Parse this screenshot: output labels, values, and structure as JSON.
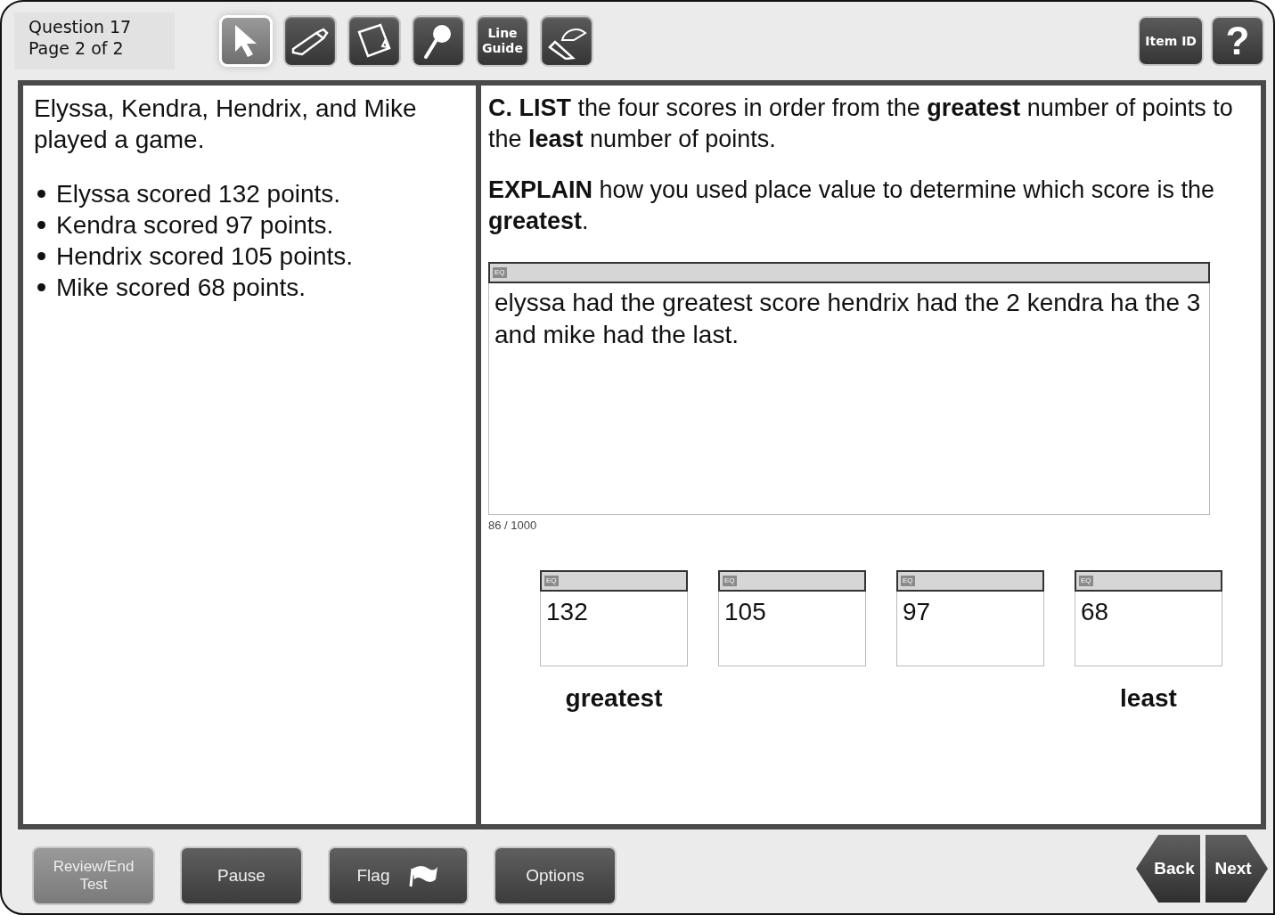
{
  "header": {
    "question": "Question 17",
    "page": "Page 2 of 2"
  },
  "tools": [
    {
      "kind": "pointer",
      "selected": true
    },
    {
      "kind": "highlighter",
      "selected": false
    },
    {
      "kind": "notepad",
      "selected": false
    },
    {
      "kind": "magnifier",
      "selected": false
    },
    {
      "kind": "line-guide",
      "label": "Line Guide",
      "selected": false
    },
    {
      "kind": "protractor",
      "selected": false
    }
  ],
  "help_buttons": [
    {
      "kind": "item-id",
      "label": "Item ID"
    },
    {
      "kind": "help",
      "label": "?"
    }
  ],
  "passage": {
    "intro": "Elyssa, Kendra, Hendrix, and Mike played a game.",
    "bullets": [
      "Elyssa scored 132 points.",
      "Kendra scored 97 points.",
      "Hendrix scored 105 points.",
      "Mike scored 68 points."
    ]
  },
  "question": {
    "paragraphs": [
      "**C.  LIST** the four scores in order from the **greatest** number of points to the **least** number of points.",
      "**EXPLAIN** how you used place value to determine which score is the **greatest**."
    ],
    "response": {
      "eq_label": "EQ",
      "value": "elyssa had the greatest score hendrix had the 2 kendra ha the 3 and mike had the last.",
      "counter": "86 / 1000"
    },
    "order_boxes": [
      {
        "eq_label": "EQ",
        "value": "132",
        "caption": "greatest"
      },
      {
        "eq_label": "EQ",
        "value": "105"
      },
      {
        "eq_label": "EQ",
        "value": "97"
      },
      {
        "eq_label": "EQ",
        "value": "68",
        "caption": "least"
      }
    ]
  },
  "footer": {
    "buttons": [
      {
        "kind": "review",
        "label": "Review/End Test"
      },
      {
        "kind": "pause",
        "label": "Pause"
      },
      {
        "kind": "flag",
        "label": "Flag"
      },
      {
        "kind": "options",
        "label": "Options"
      }
    ],
    "nav": [
      {
        "kind": "back",
        "label": "Back"
      },
      {
        "kind": "next",
        "label": "Next"
      }
    ]
  }
}
